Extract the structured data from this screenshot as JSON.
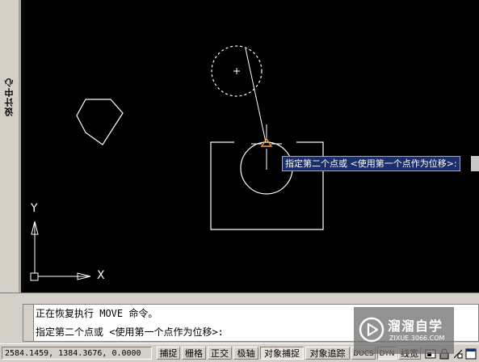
{
  "side_panel": {
    "label": "设计中心"
  },
  "drawing": {
    "tooltip": "指定第二个点或 <使用第一个点作为位移>:",
    "ucs": {
      "x_label": "X",
      "y_label": "Y"
    }
  },
  "command": {
    "line1": "正在恢复执行 MOVE 命令。",
    "line2": "指定第二个点或 <使用第一个点作为位移>:"
  },
  "status_bar": {
    "coordinates": "2584.1459, 1384.3676, 0.0000",
    "toggles": [
      {
        "label": "捕捉",
        "on": false
      },
      {
        "label": "栅格",
        "on": false
      },
      {
        "label": "正交",
        "on": false
      },
      {
        "label": "极轴",
        "on": false
      },
      {
        "label": "对象捕捉",
        "on": true
      },
      {
        "label": "对象追踪",
        "on": false
      },
      {
        "label": "DUCS",
        "on": false
      },
      {
        "label": "DYN",
        "on": true
      },
      {
        "label": "线宽",
        "on": false
      }
    ]
  },
  "watermark": {
    "name": "溜溜自学",
    "url": "ZIXUE.3066.COM"
  },
  "colors": {
    "canvas": "#000000",
    "entities": "#ffffff",
    "snap_marker": "#ffa040",
    "tooltip_bg": "#1a2e6a"
  }
}
